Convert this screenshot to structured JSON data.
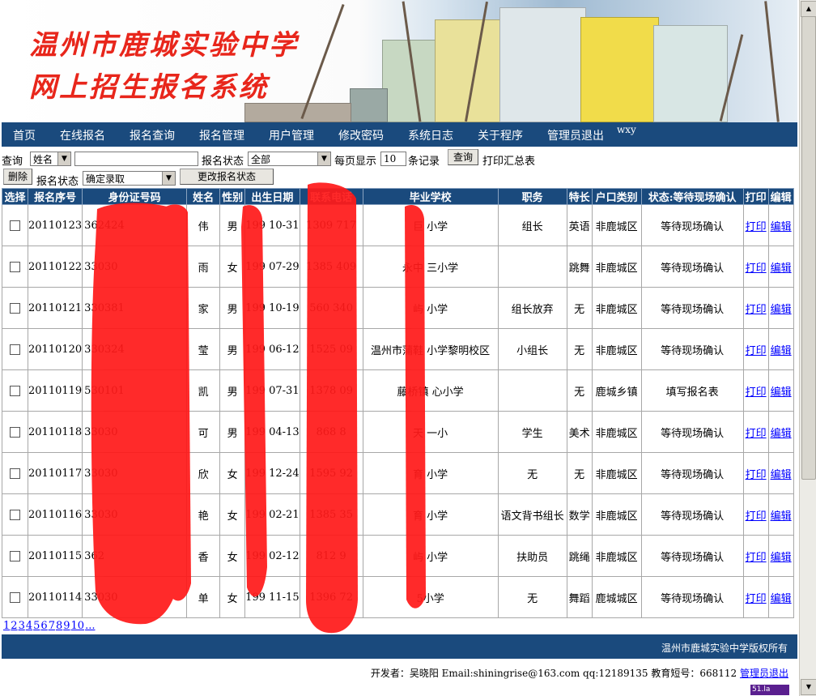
{
  "banner": {
    "title_line1": "温州市鹿城实验中学",
    "title_line2": "网上招生报名系统"
  },
  "nav": {
    "items": [
      "首页",
      "在线报名",
      "报名查询",
      "报名管理",
      "用户管理",
      "修改密码",
      "系统日志",
      "关于程序",
      "管理员退出"
    ],
    "user": "wxy"
  },
  "query": {
    "label": "查询",
    "field_select": "姓名",
    "keyword": "",
    "status_label": "报名状态",
    "status_select": "全部",
    "per_page_prefix": "每页显示",
    "per_page_value": "10",
    "per_page_suffix": "条记录",
    "query_button": "查询",
    "print_summary": "打印汇总表"
  },
  "batch": {
    "delete_button": "删除",
    "status_label": "报名状态",
    "status_select": "确定录取",
    "change_button": "更改报名状态"
  },
  "table": {
    "headers": [
      "选择",
      "报名序号",
      "身份证号码",
      "姓名",
      "性别",
      "出生日期",
      "联系电话",
      "毕业学校",
      "职务",
      "特长",
      "户口类别",
      "状态:等待现场确认",
      "打印",
      "编辑"
    ],
    "rows": [
      {
        "seq": "20110123",
        "id": "362424",
        "name": "伟",
        "gender": "男",
        "birth": "199  10-31",
        "phone": "1309    717",
        "school": "巨    小学",
        "duty": "组长",
        "talent": "英语",
        "hukou": "非鹿城区",
        "status": "等待现场确认",
        "print": "打印",
        "edit": "编辑"
      },
      {
        "seq": "20110122",
        "id": "33030",
        "name": "雨",
        "gender": "女",
        "birth": "199  07-29",
        "phone": "1385   409",
        "school": "永中    三小学",
        "duty": "",
        "talent": "跳舞",
        "hukou": "非鹿城区",
        "status": "等待现场确认",
        "print": "打印",
        "edit": "编辑"
      },
      {
        "seq": "20110121",
        "id": "330381",
        "name": "家",
        "gender": "男",
        "birth": "199  10-19",
        "phone": "560  340",
        "school": "屿    小学",
        "duty": "组长放弃",
        "talent": "无",
        "hukou": "非鹿城区",
        "status": "等待现场确认",
        "print": "打印",
        "edit": "编辑"
      },
      {
        "seq": "20110120",
        "id": "330324",
        "name": "莹",
        "gender": "男",
        "birth": "199  06-12",
        "phone": "1525    09",
        "school": "温州市蒲鞋    小学黎明校区",
        "duty": "小组长",
        "talent": "无",
        "hukou": "非鹿城区",
        "status": "等待现场确认",
        "print": "打印",
        "edit": "编辑"
      },
      {
        "seq": "20110119",
        "id": "530101",
        "name": "凯",
        "gender": "男",
        "birth": "199  07-31",
        "phone": "1378    09",
        "school": "藤桥镇    心小学",
        "duty": "",
        "talent": "无",
        "hukou": "鹿城乡镇",
        "status": "填写报名表",
        "print": "打印",
        "edit": "编辑"
      },
      {
        "seq": "20110118",
        "id": "33030",
        "name": "可",
        "gender": "男",
        "birth": "199  04-13",
        "phone": "868   8",
        "school": "天    一小",
        "duty": "学生",
        "talent": "美术",
        "hukou": "非鹿城区",
        "status": "等待现场确认",
        "print": "打印",
        "edit": "编辑"
      },
      {
        "seq": "20110117",
        "id": "33030",
        "name": "欣",
        "gender": "女",
        "birth": "199  12-24",
        "phone": "1595    92",
        "school": "育    小学",
        "duty": "无",
        "talent": "无",
        "hukou": "非鹿城区",
        "status": "等待现场确认",
        "print": "打印",
        "edit": "编辑"
      },
      {
        "seq": "20110116",
        "id": "33030",
        "name": "艳",
        "gender": "女",
        "birth": "199  02-21",
        "phone": "1385    35",
        "school": "育    小学",
        "duty": "语文背书组长",
        "talent": "数学",
        "hukou": "非鹿城区",
        "status": "等待现场确认",
        "print": "打印",
        "edit": "编辑"
      },
      {
        "seq": "20110115",
        "id": "362",
        "name": "香",
        "gender": "女",
        "birth": "199  02-12",
        "phone": "812   9",
        "school": "屿    小学",
        "duty": "扶助员",
        "talent": "跳绳",
        "hukou": "非鹿城区",
        "status": "等待现场确认",
        "print": "打印",
        "edit": "编辑"
      },
      {
        "seq": "20110114",
        "id": "33030",
        "name": "单",
        "gender": "女",
        "birth": "199  11-15",
        "phone": "1396    72",
        "school": "    5小学",
        "duty": "无",
        "talent": "舞蹈",
        "hukou": "鹿城城区",
        "status": "等待现场确认",
        "print": "打印",
        "edit": "编辑"
      }
    ]
  },
  "pager": {
    "pages": [
      "1",
      "2",
      "3",
      "4",
      "5",
      "6",
      "7",
      "8",
      "9",
      "10",
      "..."
    ]
  },
  "footer": {
    "copyright": "温州市鹿城实验中学版权所有",
    "developer": "开发者：吴晓阳  Email:shiningrise@163.com qq:12189135 教育短号：668112",
    "admin_logout": "管理员退出",
    "badge": "51.la"
  },
  "colors": {
    "nav_bg": "#1a4a7d",
    "banner_title": "#e8261b",
    "redaction": "#ff1a1a",
    "link": "#0000ff"
  }
}
